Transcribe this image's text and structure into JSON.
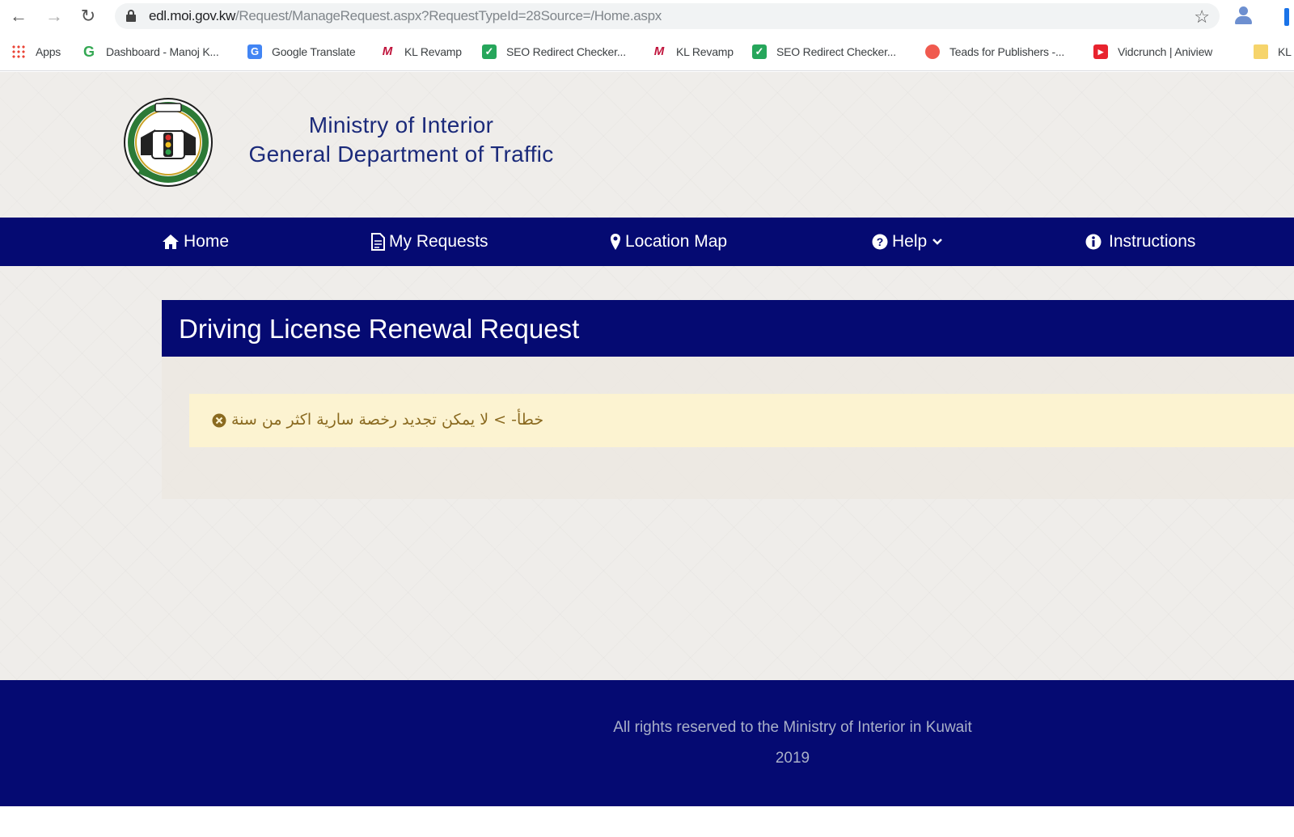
{
  "browser": {
    "url_host": "edl.moi.gov.kw",
    "url_path": "/Request/ManageRequest.aspx?RequestTypeId=28Source=/Home.aspx",
    "bookmarks": [
      {
        "label": "Apps",
        "icon": "apps-grid-icon"
      },
      {
        "label": "Dashboard - Manoj K...",
        "icon": "g-icon"
      },
      {
        "label": "Google Translate",
        "icon": "google-translate-icon"
      },
      {
        "label": "KL Revamp",
        "icon": "kl-icon"
      },
      {
        "label": "SEO Redirect Checker...",
        "icon": "seo-check-icon"
      },
      {
        "label": "KL Revamp",
        "icon": "kl-icon"
      },
      {
        "label": "SEO Redirect Checker...",
        "icon": "seo-check-icon"
      },
      {
        "label": "Teads for Publishers -...",
        "icon": "teads-icon"
      },
      {
        "label": "Vidcrunch | Aniview",
        "icon": "vidcrunch-icon"
      },
      {
        "label": "KL",
        "icon": "folder-icon"
      }
    ]
  },
  "header": {
    "title_line1": "Ministry of Interior",
    "title_line2": "General Department of Traffic"
  },
  "nav": {
    "home": "Home",
    "my_requests": "My Requests",
    "location_map": "Location Map",
    "help": "Help",
    "instructions": "Instructions"
  },
  "panel": {
    "title": "Driving License Renewal Request",
    "error_message": "خطأ- > لا يمكن تجديد رخصة سارية اكثر من سنة"
  },
  "footer": {
    "rights": "All rights reserved to the Ministry of Interior in Kuwait",
    "year": "2019"
  },
  "colors": {
    "navy": "#050a72",
    "title_blue": "#1b2a7a",
    "alert_bg": "#fcf3d1",
    "alert_text": "#8a6a20"
  }
}
